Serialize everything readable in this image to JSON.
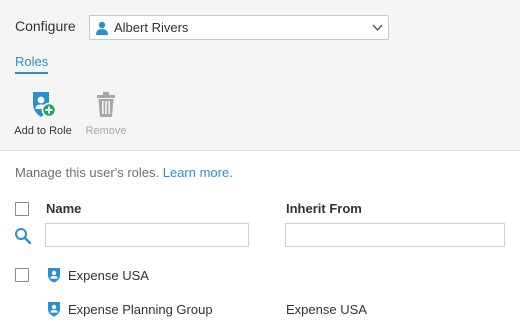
{
  "configure": {
    "label": "Configure",
    "selected_user": "Albert Rivers",
    "user_icon": "person-icon",
    "dropdown_icon": "chevron-down-icon"
  },
  "tabs": [
    {
      "label": "Roles",
      "active": true
    }
  ],
  "toolbar": {
    "add_to_role": {
      "label": "Add to Role",
      "icon": "shield-user-plus-icon",
      "enabled": true
    },
    "remove": {
      "label": "Remove",
      "icon": "trash-icon",
      "enabled": false
    }
  },
  "intro": {
    "text": "Manage this user's roles.",
    "link": "Learn more."
  },
  "table": {
    "columns": [
      "Name",
      "Inherit From"
    ],
    "filters": {
      "name": "",
      "inherit_from": ""
    },
    "rows": [
      {
        "name": "Expense USA",
        "inherit_from": "",
        "checkbox": true
      },
      {
        "name": "Expense Planning Group",
        "inherit_from": "Expense USA",
        "checkbox": false
      }
    ]
  },
  "colors": {
    "accent": "#2a8fd1",
    "panel_bg": "#f5f5f5",
    "add_badge": "#22a45a",
    "disabled": "#a6a6a6"
  }
}
